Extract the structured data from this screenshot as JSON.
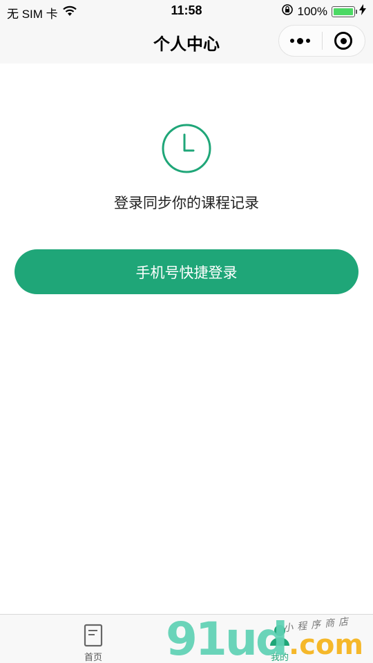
{
  "status_bar": {
    "carrier": "无 SIM 卡",
    "time": "11:58",
    "battery_percent": "100%",
    "battery_level": 1.0,
    "icons": [
      "wifi-icon",
      "orientation-lock-icon",
      "battery-icon",
      "charging-icon"
    ]
  },
  "nav": {
    "title": "个人中心",
    "more_icon": "more-dots-icon",
    "close_icon": "target-icon"
  },
  "main": {
    "icon": "clock-icon",
    "hint": "登录同步你的课程记录",
    "login_button_label": "手机号快捷登录"
  },
  "tab_bar": {
    "items": [
      {
        "label": "首页",
        "icon": "book-icon",
        "active": false
      },
      {
        "label": "我的",
        "icon": "user-icon",
        "active": true
      }
    ]
  },
  "watermark": {
    "main": "91ud",
    "tld": ".com",
    "subtitle": "小程序商店"
  },
  "colors": {
    "accent": "#1fa678",
    "nav_background": "#f7f7f7",
    "battery_fill": "#4cd964"
  }
}
